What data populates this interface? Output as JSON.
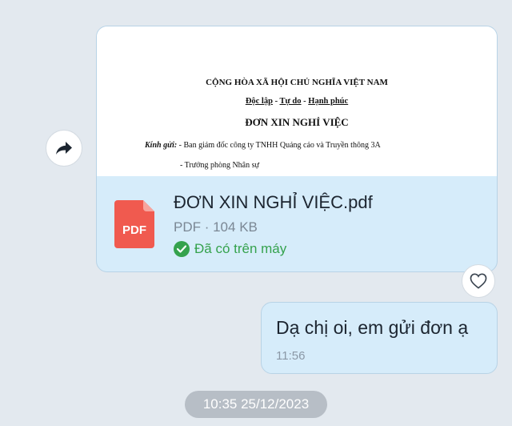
{
  "file_message": {
    "preview": {
      "heading": "CỘNG HÒA XÃ HỘI CHỦ NGHĨA VIỆT NAM",
      "motto_1": "Độc lập",
      "motto_sep_1": " - ",
      "motto_2": "Tự do",
      "motto_sep_2": " - ",
      "motto_3": "Hạnh phúc",
      "doc_title": "ĐƠN XIN NGHỈ VIỆC",
      "recipient_label": "Kính gửi:",
      "recipient_1": "  - Ban giám đốc công ty TNHH Quảng cáo và Truyền thông 3A",
      "recipient_2": "- Trưởng phòng Nhân sự"
    },
    "file_name": "ĐƠN XIN NGHỈ VIỆC.pdf",
    "file_meta": "PDF · 104 KB",
    "file_status": "Đã có trên máy",
    "icon_label": "PDF"
  },
  "text_message": {
    "text": "Dạ chị oi, em gửi đơn ạ",
    "time": "11:56"
  },
  "date_divider": "10:35 25/12/2023",
  "icons": {
    "forward": "share-arrow-icon",
    "reaction": "heart-icon",
    "file": "pdf-file-icon",
    "status": "check-circle-icon"
  },
  "colors": {
    "background": "#e3e9ef",
    "bubble": "#d6ecfa",
    "pdf_red": "#f05a4f",
    "status_green": "#35a24d"
  }
}
